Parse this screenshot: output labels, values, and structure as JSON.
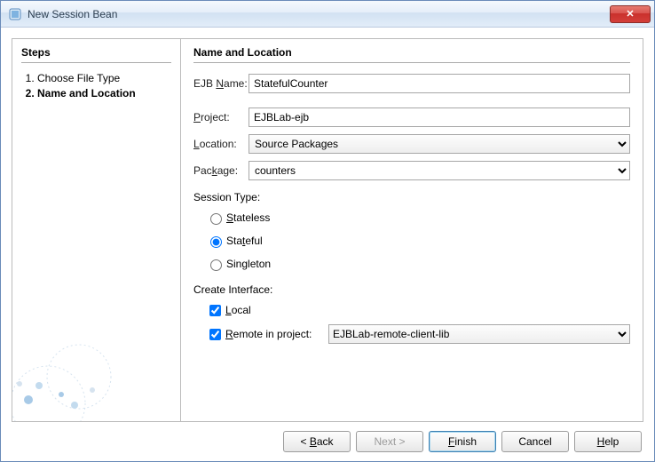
{
  "window": {
    "title": "New Session Bean"
  },
  "sidebar": {
    "heading": "Steps",
    "items": [
      {
        "label": "Choose File Type",
        "current": false
      },
      {
        "label": "Name and Location",
        "current": true
      }
    ]
  },
  "main": {
    "heading": "Name and Location",
    "ejbName": {
      "label": "EJB Name:",
      "value": "StatefulCounter",
      "mnemonic": "N"
    },
    "project": {
      "label": "Project:",
      "value": "EJBLab-ejb",
      "mnemonic": "P"
    },
    "location": {
      "label": "Location:",
      "value": "Source Packages",
      "mnemonic": "L"
    },
    "package": {
      "label": "Package:",
      "value": "counters",
      "mnemonic": "k"
    },
    "sessionType": {
      "label": "Session Type:",
      "options": {
        "stateless": {
          "label": "Stateless",
          "mnemonic": "S",
          "checked": false
        },
        "stateful": {
          "label": "Stateful",
          "mnemonic": "t",
          "checked": true
        },
        "singleton": {
          "label": "Singleton",
          "mnemonic": "g",
          "checked": false
        }
      }
    },
    "createInterface": {
      "label": "Create Interface:",
      "local": {
        "label": "Local",
        "mnemonic": "L",
        "checked": true
      },
      "remote": {
        "label": "Remote in project:",
        "mnemonic": "R",
        "checked": true,
        "value": "EJBLab-remote-client-lib"
      }
    }
  },
  "buttons": {
    "back": "< Back",
    "next": "Next >",
    "finish": "Finish",
    "cancel": "Cancel",
    "help": "Help"
  }
}
